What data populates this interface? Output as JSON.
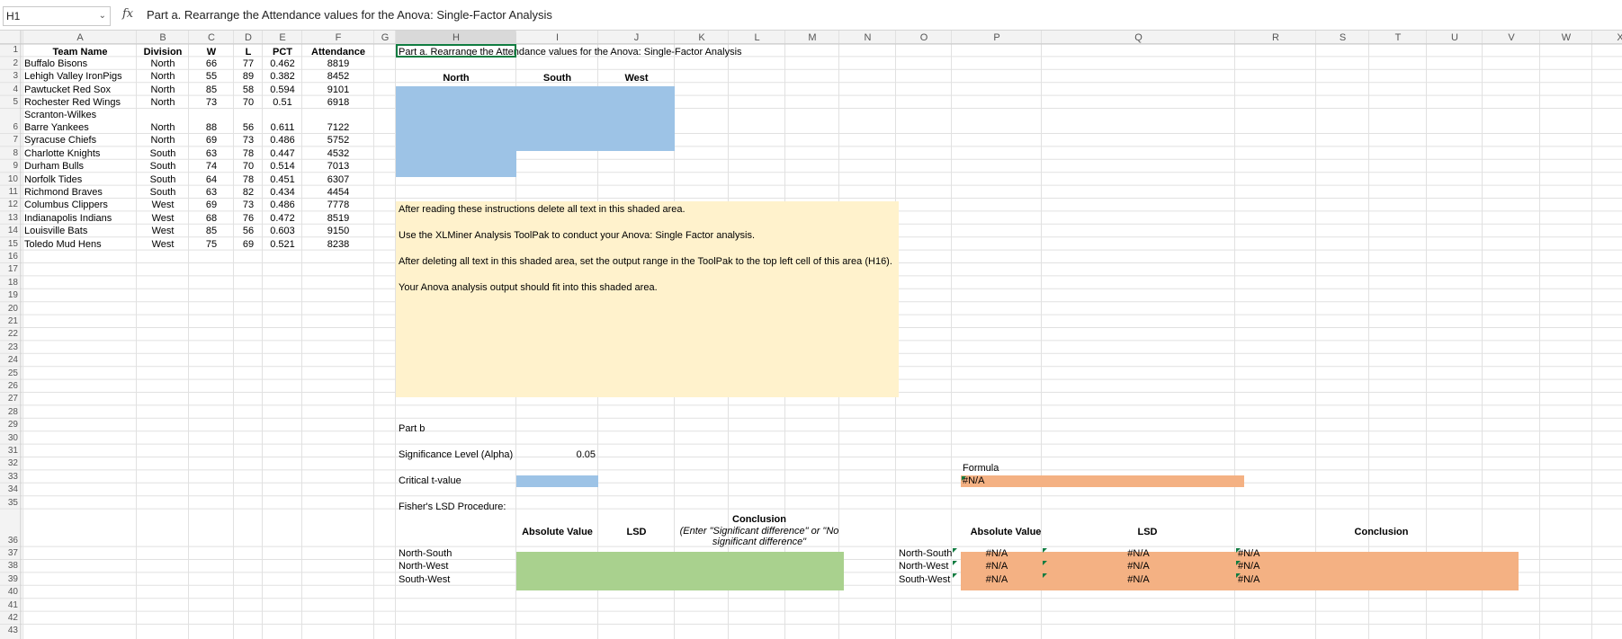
{
  "formula_bar": {
    "name_box": "H1",
    "fx_label": "fx",
    "formula": "Part a. Rearrange the Attendance values for the Anova: Single-Factor Analysis"
  },
  "columns": [
    "A",
    "B",
    "C",
    "D",
    "E",
    "F",
    "G",
    "H",
    "I",
    "J",
    "K",
    "L",
    "M",
    "N",
    "O",
    "P",
    "Q",
    "R",
    "S",
    "T",
    "U",
    "V",
    "W",
    "X"
  ],
  "rows": [
    "1",
    "2",
    "3",
    "4",
    "5",
    "6",
    "7",
    "8",
    "9",
    "10",
    "11",
    "12",
    "13",
    "14",
    "15",
    "16",
    "17",
    "18",
    "19",
    "20",
    "21",
    "22",
    "23",
    "24",
    "25",
    "26",
    "27",
    "28",
    "29",
    "30",
    "31",
    "32",
    "33",
    "34",
    "35",
    "36",
    "37",
    "38",
    "39",
    "40",
    "41",
    "42",
    "43"
  ],
  "headers": [
    "Team Name",
    "Division",
    "W",
    "L",
    "PCT",
    "Attendance"
  ],
  "teams": [
    {
      "name": "Buffalo Bisons",
      "division": "North",
      "w": "66",
      "l": "77",
      "pct": "0.462",
      "att": "8819"
    },
    {
      "name": "Lehigh Valley IronPigs",
      "division": "North",
      "w": "55",
      "l": "89",
      "pct": "0.382",
      "att": "8452"
    },
    {
      "name": "Pawtucket Red Sox",
      "division": "North",
      "w": "85",
      "l": "58",
      "pct": "0.594",
      "att": "9101"
    },
    {
      "name": "Rochester Red Wings",
      "division": "North",
      "w": "73",
      "l": "70",
      "pct": "0.51",
      "att": "6918"
    },
    {
      "name": "Scranton-Wilkes",
      "name2": "Barre Yankees",
      "division": "North",
      "w": "88",
      "l": "56",
      "pct": "0.611",
      "att": "7122"
    },
    {
      "name": "Syracuse Chiefs",
      "division": "North",
      "w": "69",
      "l": "73",
      "pct": "0.486",
      "att": "5752"
    },
    {
      "name": "Charlotte Knights",
      "division": "South",
      "w": "63",
      "l": "78",
      "pct": "0.447",
      "att": "4532"
    },
    {
      "name": "Durham Bulls",
      "division": "South",
      "w": "74",
      "l": "70",
      "pct": "0.514",
      "att": "7013"
    },
    {
      "name": "Norfolk Tides",
      "division": "South",
      "w": "64",
      "l": "78",
      "pct": "0.451",
      "att": "6307"
    },
    {
      "name": "Richmond Braves",
      "division": "South",
      "w": "63",
      "l": "82",
      "pct": "0.434",
      "att": "4454"
    },
    {
      "name": "Columbus Clippers",
      "division": "West",
      "w": "69",
      "l": "73",
      "pct": "0.486",
      "att": "7778"
    },
    {
      "name": "Indianapolis Indians",
      "division": "West",
      "w": "68",
      "l": "76",
      "pct": "0.472",
      "att": "8519"
    },
    {
      "name": "Louisville Bats",
      "division": "West",
      "w": "85",
      "l": "56",
      "pct": "0.603",
      "att": "9150"
    },
    {
      "name": "Toledo Mud Hens",
      "division": "West",
      "w": "75",
      "l": "69",
      "pct": "0.521",
      "att": "8238"
    }
  ],
  "part_a": {
    "title": "Part a. Rearrange the Attendance values for the Anova: Single-Factor Analysis",
    "groups": [
      "North",
      "South",
      "West"
    ],
    "instructions": [
      "After reading these instructions delete all text in this shaded area.",
      "Use the XLMiner Analysis ToolPak to conduct your Anova: Single Factor analysis.",
      "After deleting all text in this shaded area, set the output range in the ToolPak to the top left cell of this area (H16).",
      "Your Anova analysis output should fit into this shaded area."
    ]
  },
  "part_b": {
    "title": "Part b",
    "alpha_label": "Significance Level (Alpha)",
    "alpha_value": "0.05",
    "crit_label": "Critical t-value",
    "formula_label": "Formula",
    "crit_formula": "#N/A",
    "lsd_label": "Fisher's LSD Procedure:",
    "headers": [
      "Absolute Value",
      "LSD"
    ],
    "conclusion_title": "Conclusion",
    "conclusion_hint": "(Enter \"Significant difference\" or \"No significant difference\"",
    "conclusion_right": "Conclusion",
    "pairs": [
      "North-South",
      "North-West",
      "South-West"
    ],
    "na": "#N/A"
  },
  "colors": {
    "blue": "#9dc3e6",
    "yellow": "#fff2cc",
    "green": "#a9d18e",
    "orange": "#f4b183",
    "grid": "#e1e1e1",
    "header_bg": "#f3f3f3"
  }
}
